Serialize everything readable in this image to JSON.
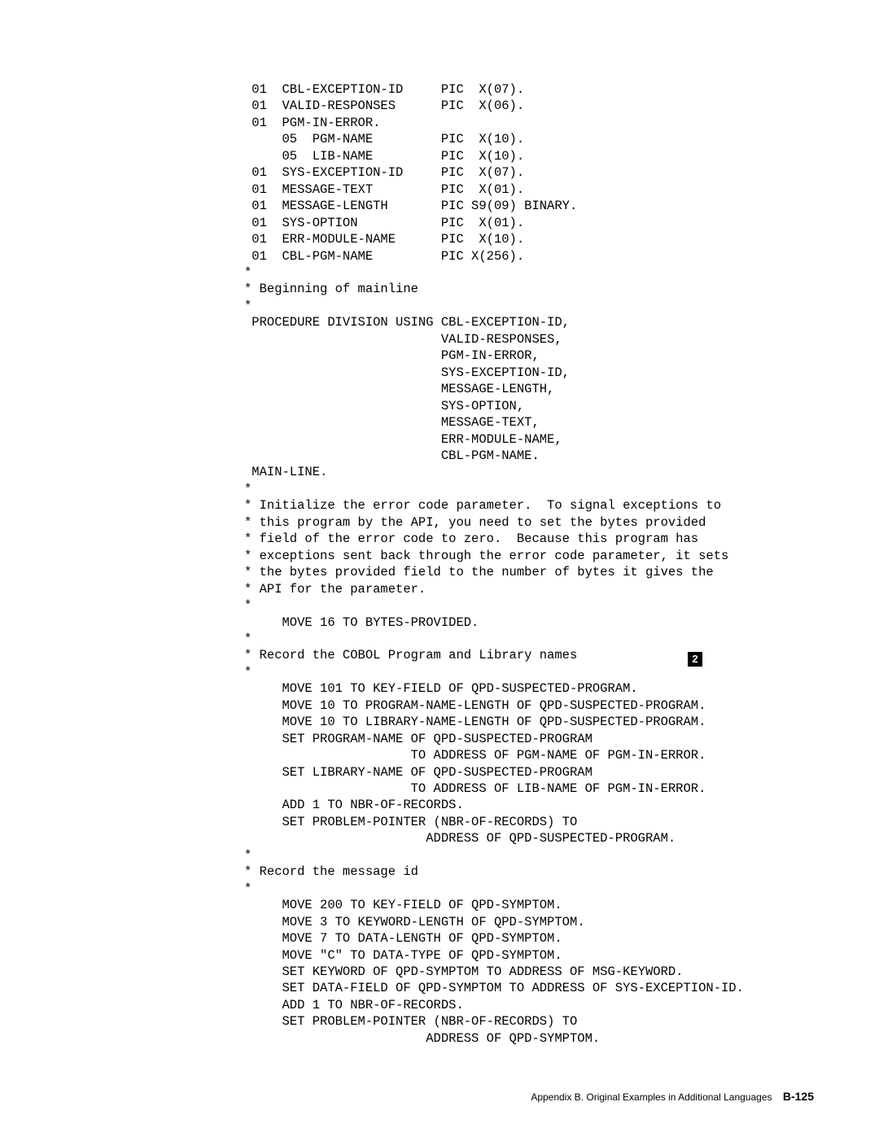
{
  "code": {
    "lines": [
      " 01  CBL-EXCEPTION-ID     PIC  X(07).",
      " 01  VALID-RESPONSES      PIC  X(06).",
      " 01  PGM-IN-ERROR.",
      "     05  PGM-NAME         PIC  X(10).",
      "     05  LIB-NAME         PIC  X(10).",
      " 01  SYS-EXCEPTION-ID     PIC  X(07).",
      " 01  MESSAGE-TEXT         PIC  X(01).",
      " 01  MESSAGE-LENGTH       PIC S9(09) BINARY.",
      " 01  SYS-OPTION           PIC  X(01).",
      " 01  ERR-MODULE-NAME      PIC  X(10).",
      " 01  CBL-PGM-NAME         PIC X(256).",
      "*",
      "* Beginning of mainline",
      "*",
      " PROCEDURE DIVISION USING CBL-EXCEPTION-ID,",
      "                          VALID-RESPONSES,",
      "                          PGM-IN-ERROR,",
      "                          SYS-EXCEPTION-ID,",
      "                          MESSAGE-LENGTH,",
      "                          SYS-OPTION,",
      "                          MESSAGE-TEXT,",
      "                          ERR-MODULE-NAME,",
      "                          CBL-PGM-NAME.",
      " MAIN-LINE.",
      "*",
      "* Initialize the error code parameter.  To signal exceptions to",
      "* this program by the API, you need to set the bytes provided",
      "* field of the error code to zero.  Because this program has",
      "* exceptions sent back through the error code parameter, it sets",
      "* the bytes provided field to the number of bytes it gives the",
      "* API for the parameter.",
      "*",
      "     MOVE 16 TO BYTES-PROVIDED.",
      "*",
      "* Record the COBOL Program and Library names",
      "*",
      "     MOVE 101 TO KEY-FIELD OF QPD-SUSPECTED-PROGRAM.",
      "     MOVE 10 TO PROGRAM-NAME-LENGTH OF QPD-SUSPECTED-PROGRAM.",
      "     MOVE 10 TO LIBRARY-NAME-LENGTH OF QPD-SUSPECTED-PROGRAM.",
      "     SET PROGRAM-NAME OF QPD-SUSPECTED-PROGRAM",
      "                      TO ADDRESS OF PGM-NAME OF PGM-IN-ERROR.",
      "     SET LIBRARY-NAME OF QPD-SUSPECTED-PROGRAM",
      "                      TO ADDRESS OF LIB-NAME OF PGM-IN-ERROR.",
      "     ADD 1 TO NBR-OF-RECORDS.",
      "     SET PROBLEM-POINTER (NBR-OF-RECORDS) TO",
      "                        ADDRESS OF QPD-SUSPECTED-PROGRAM.",
      "*",
      "* Record the message id",
      "*",
      "     MOVE 200 TO KEY-FIELD OF QPD-SYMPTOM.",
      "     MOVE 3 TO KEYWORD-LENGTH OF QPD-SYMPTOM.",
      "     MOVE 7 TO DATA-LENGTH OF QPD-SYMPTOM.",
      "     MOVE \"C\" TO DATA-TYPE OF QPD-SYMPTOM.",
      "     SET KEYWORD OF QPD-SYMPTOM TO ADDRESS OF MSG-KEYWORD.",
      "     SET DATA-FIELD OF QPD-SYMPTOM TO ADDRESS OF SYS-EXCEPTION-ID.",
      "     ADD 1 TO NBR-OF-RECORDS.",
      "     SET PROBLEM-POINTER (NBR-OF-RECORDS) TO",
      "                        ADDRESS OF QPD-SYMPTOM."
    ]
  },
  "callout": {
    "label": "2"
  },
  "footer": {
    "text": "Appendix B. Original Examples in Additional Languages",
    "page": "B-125"
  }
}
